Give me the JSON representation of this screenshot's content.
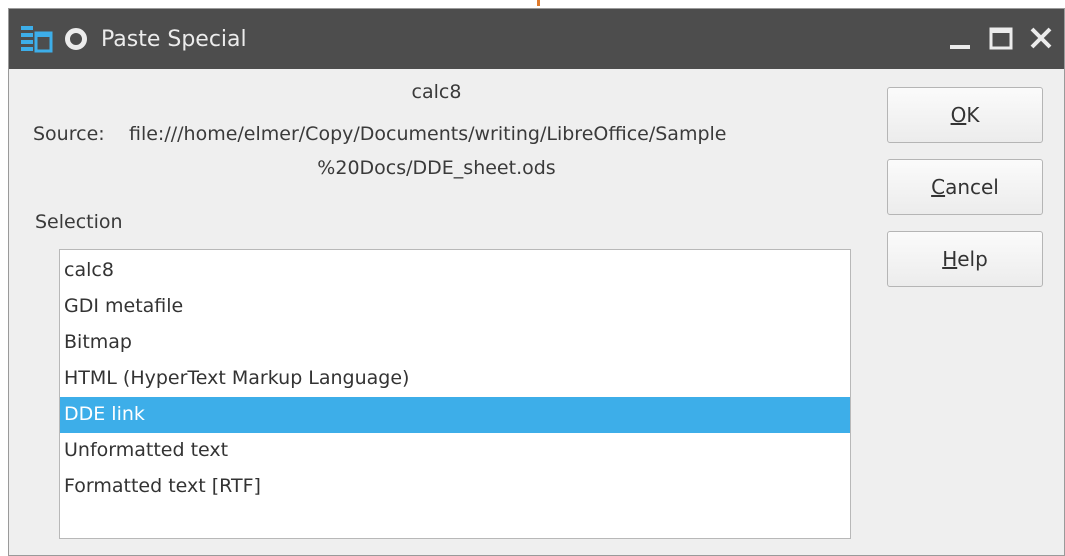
{
  "window": {
    "title": "Paste Special"
  },
  "header": {
    "app_name": "calc8",
    "source_label": "Source:",
    "source_line1": "file:///home/elmer/Copy/Documents/writing/LibreOffice/Sample",
    "source_line2": "%20Docs/DDE_sheet.ods"
  },
  "selection": {
    "label": "Selection",
    "items": [
      {
        "label": "calc8",
        "selected": false
      },
      {
        "label": "GDI metafile",
        "selected": false
      },
      {
        "label": "Bitmap",
        "selected": false
      },
      {
        "label": "HTML (HyperText Markup Language)",
        "selected": false
      },
      {
        "label": "DDE link",
        "selected": true
      },
      {
        "label": "Unformatted text",
        "selected": false
      },
      {
        "label": "Formatted text [RTF]",
        "selected": false
      }
    ]
  },
  "buttons": {
    "ok": {
      "mnemonic": "O",
      "rest": "K"
    },
    "cancel": {
      "mnemonic": "C",
      "rest": "ancel"
    },
    "help": {
      "mnemonic": "H",
      "rest": "elp"
    }
  },
  "icons": {
    "app": "libreoffice-app-icon",
    "pin": "keep-above-icon",
    "minimize": "minimize-icon",
    "maximize": "maximize-icon",
    "close": "close-icon"
  },
  "colors": {
    "titlebar": "#4d4d4d",
    "selection_highlight": "#3daee9"
  }
}
